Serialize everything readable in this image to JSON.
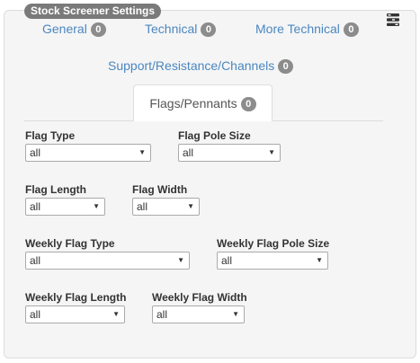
{
  "panel": {
    "title": "Stock Screener Settings",
    "menu_icon": "menu-icon"
  },
  "tabs": [
    {
      "label": "General",
      "count": "0"
    },
    {
      "label": "Technical",
      "count": "0"
    },
    {
      "label": "More Technical",
      "count": "0"
    },
    {
      "label": "Support/Resistance/Channels",
      "count": "0"
    },
    {
      "label": "Flags/Pennants",
      "count": "0",
      "active": true
    }
  ],
  "fields": {
    "flag_type": {
      "label": "Flag Type",
      "value": "all"
    },
    "flag_pole_size": {
      "label": "Flag Pole Size",
      "value": "all"
    },
    "flag_length": {
      "label": "Flag Length",
      "value": "all"
    },
    "flag_width": {
      "label": "Flag Width",
      "value": "all"
    },
    "weekly_flag_type": {
      "label": "Weekly Flag Type",
      "value": "all"
    },
    "weekly_flag_pole_size": {
      "label": "Weekly Flag Pole Size",
      "value": "all"
    },
    "weekly_flag_length": {
      "label": "Weekly Flag Length",
      "value": "all"
    },
    "weekly_flag_width": {
      "label": "Weekly Flag Width",
      "value": "all"
    }
  },
  "colors": {
    "link": "#4b87c0",
    "badge": "#8c8c8c",
    "title_badge": "#7a7a7a",
    "panel_bg": "#f5f5f5"
  }
}
